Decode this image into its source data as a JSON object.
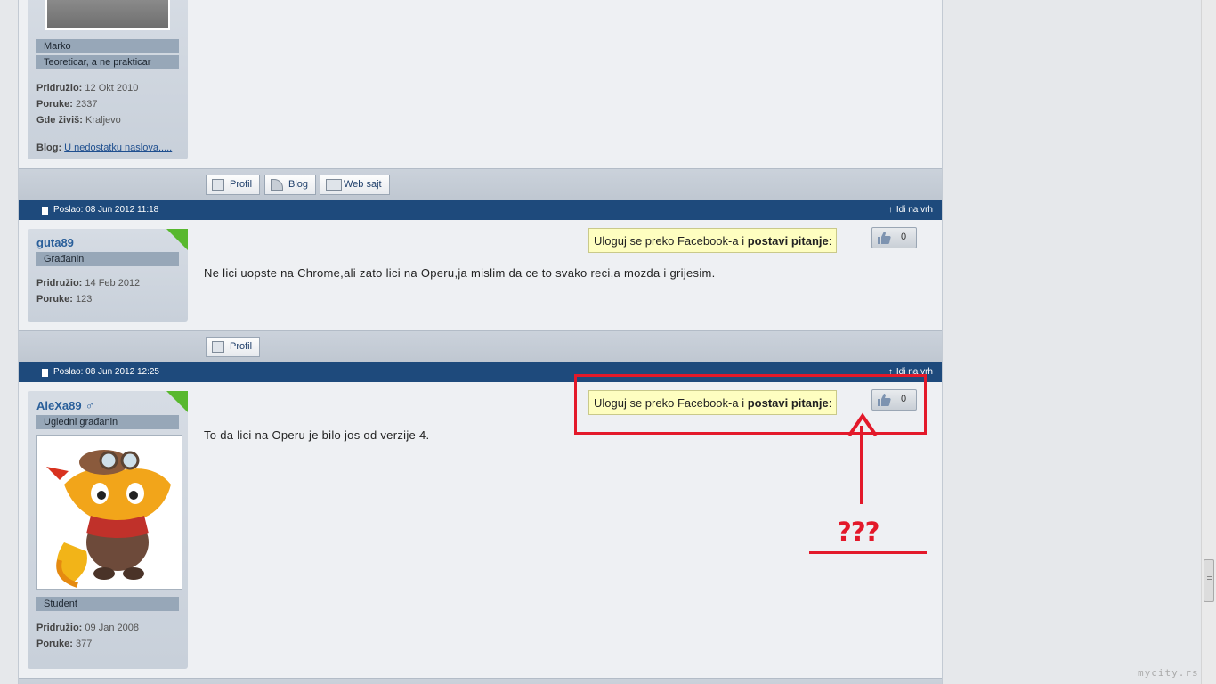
{
  "post1": {
    "user_tags": [
      "Marko",
      "Teoreticar, a ne prakticar"
    ],
    "stats": [
      {
        "label": "Pridružio:",
        "value": "12 Okt 2010"
      },
      {
        "label": "Poruke:",
        "value": "2337"
      },
      {
        "label": "Gde živiš:",
        "value": "Kraljevo"
      }
    ],
    "blog_label": "Blog:",
    "blog_link": "U nedostatku naslova.....",
    "buttons": [
      "Profil",
      "Blog",
      "Web sajt"
    ]
  },
  "post2": {
    "posted": "Poslao: 08 Jun 2012 11:18",
    "top_link": "Idi na vrh",
    "username": "guta89",
    "rank": "Građanin",
    "stats": [
      {
        "label": "Pridružio:",
        "value": "14 Feb 2012"
      },
      {
        "label": "Poruke:",
        "value": "123"
      }
    ],
    "fb_text": "Uloguj se preko Facebook-a i ",
    "fb_bold": "postavi pitanje",
    "fb_colon": ":",
    "likes": "0",
    "body": "Ne lici uopste na Chrome,ali zato lici na Operu,ja mislim da ce to svako reci,a mozda i grijesim.",
    "buttons": [
      "Profil"
    ]
  },
  "post3": {
    "posted": "Poslao: 08 Jun 2012 12:25",
    "top_link": "Idi na vrh",
    "username": "AleXa89",
    "gender_symbol": "♂",
    "rank": "Ugledni građanin",
    "extra_tag": "Student",
    "stats": [
      {
        "label": "Pridružio:",
        "value": "09 Jan 2008"
      },
      {
        "label": "Poruke:",
        "value": "377"
      }
    ],
    "fb_text": "Uloguj se preko Facebook-a i ",
    "fb_bold": "postavi pitanje",
    "fb_colon": ":",
    "likes": "0",
    "body": "To da lici na Operu je bilo jos od verzije 4."
  },
  "annotation": {
    "text": "???",
    "color": "#e3192a"
  },
  "watermark": "mycity.rs",
  "colors": {
    "post_bar": "#1e4a7c",
    "username": "#2a5f9a",
    "online_corner": "#58b82e"
  }
}
